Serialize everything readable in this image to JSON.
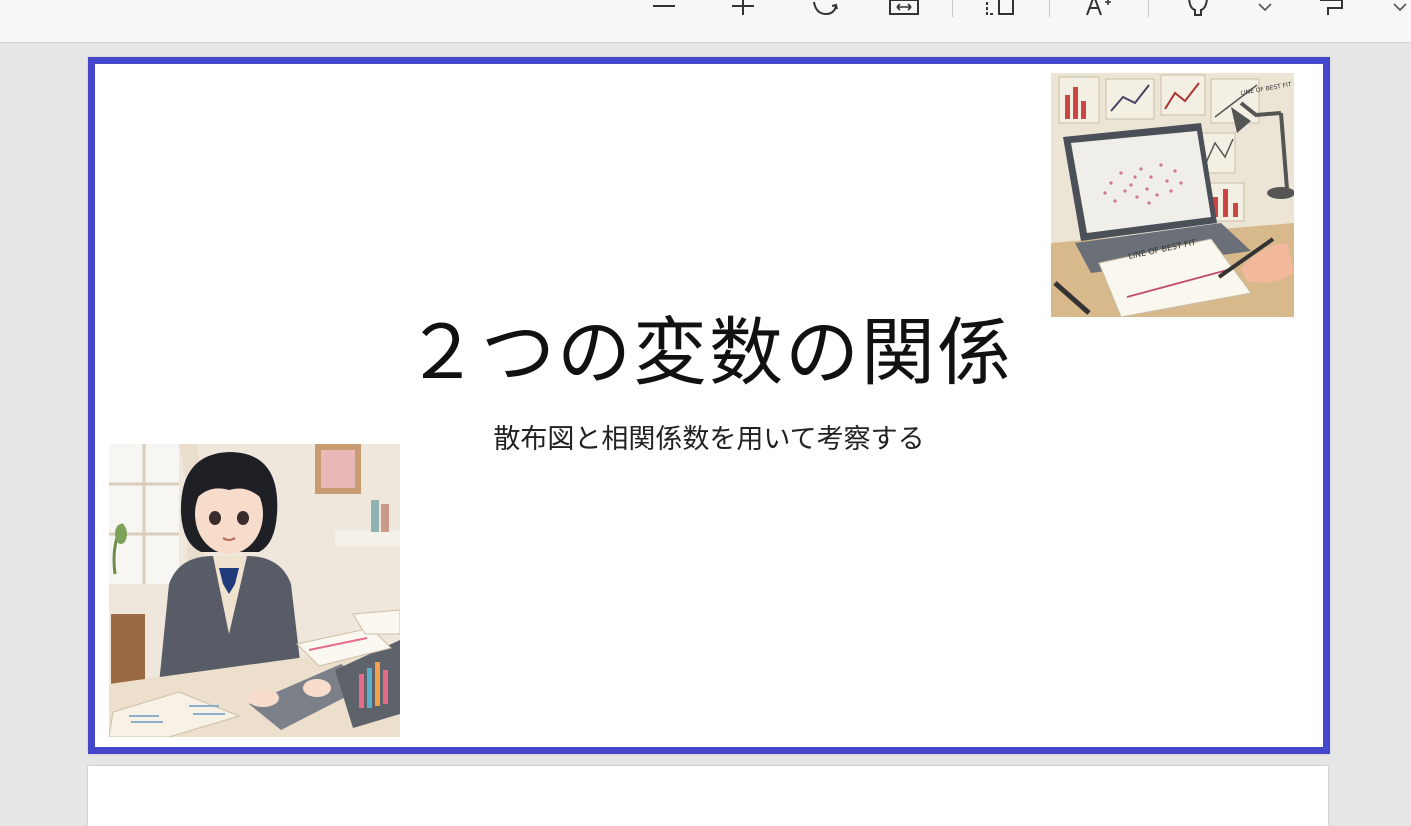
{
  "toolbar": {
    "icons": [
      "line-spacing-icon",
      "add-icon",
      "rotate-icon",
      "fit-icon",
      "layout-icon",
      "font-size-icon",
      "designer-icon",
      "dropdown-icon",
      "format-painter-icon",
      "dropdown-icon"
    ]
  },
  "slide": {
    "title": "２つの変数の関係",
    "subtitle": "散布図と相関係数を用いて考察する",
    "chart_image_labels": [
      "LINE OF BEST FIT",
      "LINE OF BEST FIT"
    ]
  },
  "colors": {
    "selection_border": "#4447c9",
    "toolbar_bg": "#f7f7f7",
    "canvas_bg": "#e6e6e6"
  }
}
